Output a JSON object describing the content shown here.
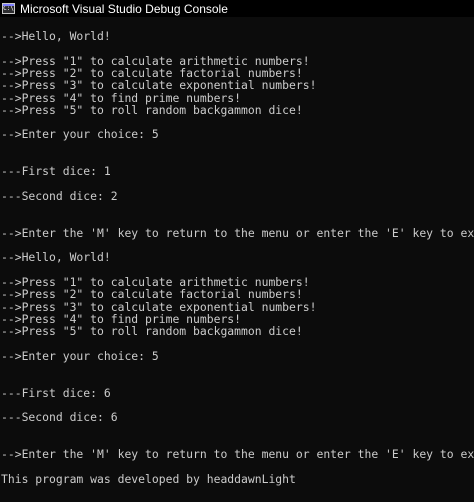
{
  "window": {
    "title": "Microsoft Visual Studio Debug Console",
    "icon": "console-app-icon",
    "icon_glyph": "C:\\"
  },
  "colors": {
    "background": "#0c0c0c",
    "text": "#cccccc",
    "titlebar": "#000000"
  },
  "console_lines": [
    "-->Hello, World!",
    "",
    "-->Press \"1\" to calculate arithmetic numbers!",
    "-->Press \"2\" to calculate factorial numbers!",
    "-->Press \"3\" to calculate exponential numbers!",
    "-->Press \"4\" to find prime numbers!",
    "-->Press \"5\" to roll random backgammon dice!",
    "",
    "-->Enter your choice: 5",
    "",
    "",
    "---First dice: 1",
    "",
    "---Second dice: 2",
    "",
    "",
    "-->Enter the 'M' key to return to the menu or enter the 'E' key to exit: m",
    "",
    "-->Hello, World!",
    "",
    "-->Press \"1\" to calculate arithmetic numbers!",
    "-->Press \"2\" to calculate factorial numbers!",
    "-->Press \"3\" to calculate exponential numbers!",
    "-->Press \"4\" to find prime numbers!",
    "-->Press \"5\" to roll random backgammon dice!",
    "",
    "-->Enter your choice: 5",
    "",
    "",
    "---First dice: 6",
    "",
    "---Second dice: 6",
    "",
    "",
    "-->Enter the 'M' key to return to the menu or enter the 'E' key to exit: e",
    "",
    "This program was developed by headdawnLight"
  ]
}
